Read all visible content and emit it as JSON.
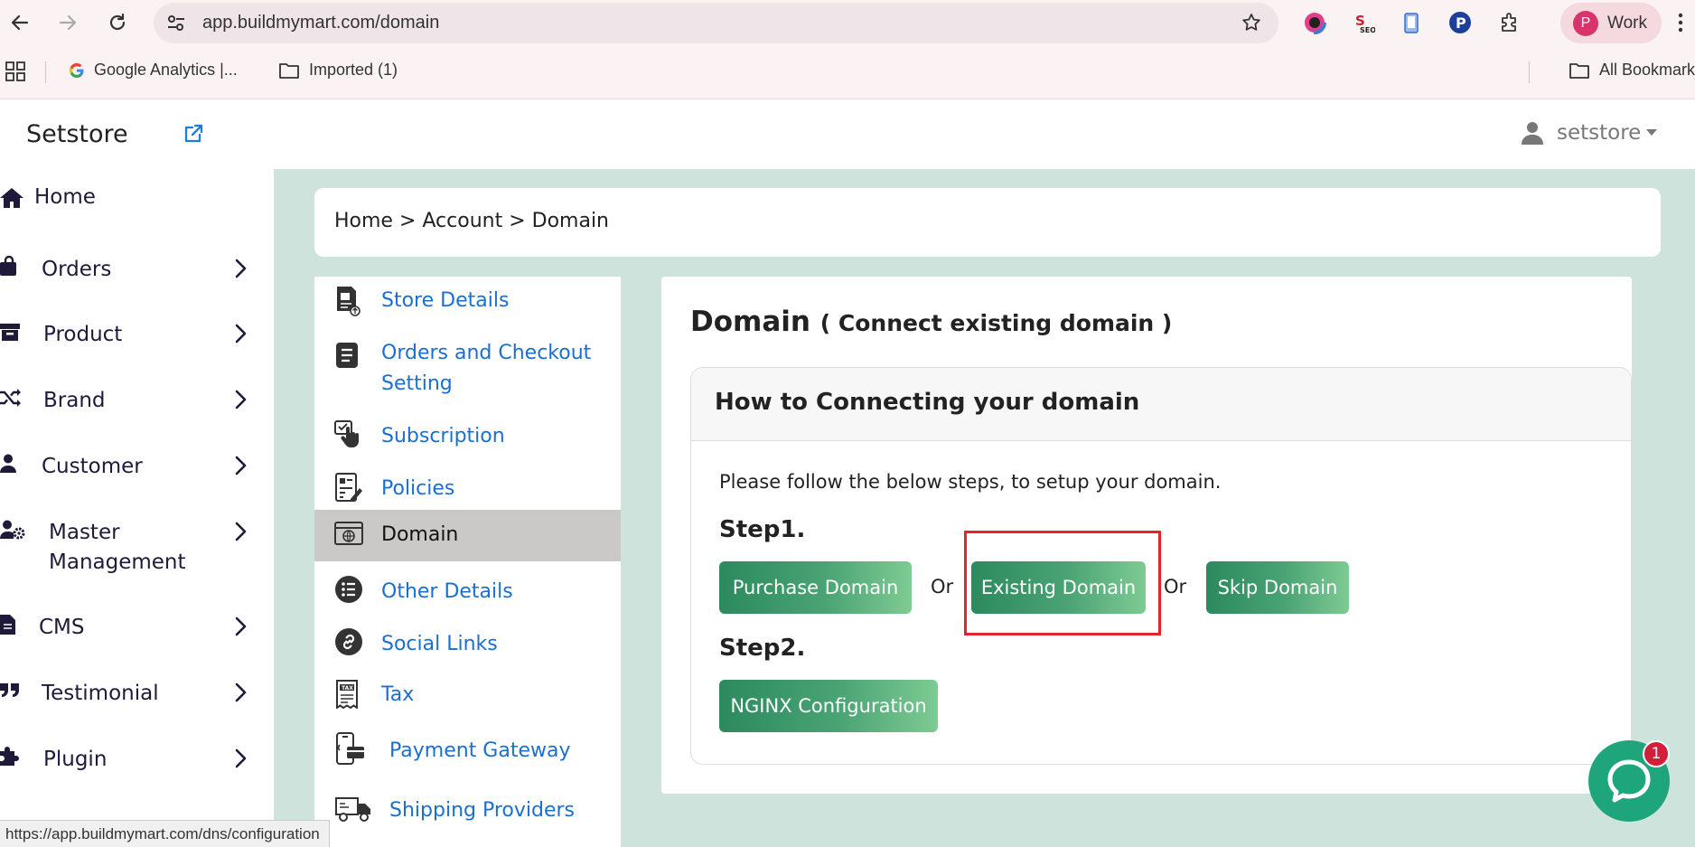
{
  "browser": {
    "url": "app.buildmymart.com/domain",
    "profile_initial": "P",
    "profile_label": "Work",
    "status_url": "https://app.buildmymart.com/dns/configuration"
  },
  "bookmarks": {
    "items": [
      "Google Analytics  |...",
      "Imported (1)"
    ],
    "all_bookmarks": "All Bookmarks"
  },
  "header": {
    "brand": "Setstore",
    "user": "setstore"
  },
  "sidebar": {
    "items": [
      {
        "label": "Home",
        "icon": "home-icon"
      },
      {
        "label": "Orders",
        "icon": "shopping-bag-icon"
      },
      {
        "label": "Product",
        "icon": "archive-box-icon"
      },
      {
        "label": "Brand",
        "icon": "shuffle-icon"
      },
      {
        "label": "Customer",
        "icon": "user-icon"
      },
      {
        "label": "Master Management",
        "icon": "user-cog-icon"
      },
      {
        "label": "CMS",
        "icon": "document-icon"
      },
      {
        "label": "Testimonial",
        "icon": "quote-icon"
      },
      {
        "label": "Plugin",
        "icon": "puzzle-icon"
      }
    ]
  },
  "breadcrumb": "Home > Account > Domain",
  "settings_menu": {
    "items": [
      {
        "label": "Store Details"
      },
      {
        "label": "Orders and Checkout Setting"
      },
      {
        "label": "Subscription"
      },
      {
        "label": "Policies"
      },
      {
        "label": "Domain"
      },
      {
        "label": "Other Details"
      },
      {
        "label": "Social Links"
      },
      {
        "label": "Tax"
      },
      {
        "label": "Payment Gateway"
      },
      {
        "label": "Shipping Providers"
      }
    ]
  },
  "domain": {
    "title": "Domain",
    "subtitle": "( Connect existing domain )",
    "card_title": "How to Connecting your domain",
    "instructions": "Please follow the below steps, to setup your domain.",
    "step1": "Step1.",
    "step2": "Step2.",
    "btn_purchase": "Purchase Domain",
    "btn_existing": "Existing Domain",
    "btn_skip": "Skip Domain",
    "btn_nginx": "NGINX Configuration",
    "or": "Or"
  },
  "chat": {
    "badge": "1"
  },
  "colors": {
    "accent_green": "#2b8a5e",
    "link_blue": "#1a6fd1",
    "content_bg": "#cfe3dd",
    "highlight_red": "#e0262b"
  }
}
